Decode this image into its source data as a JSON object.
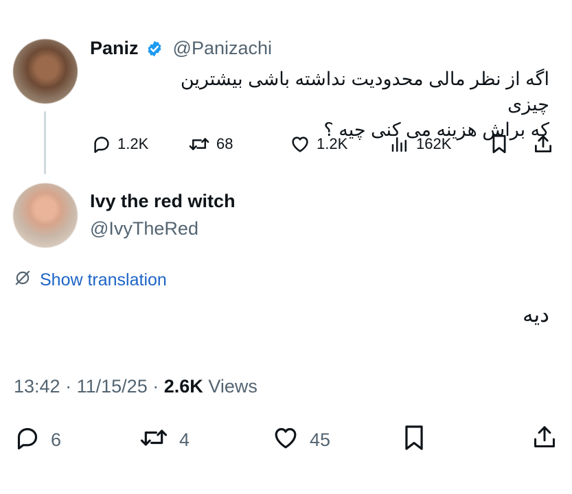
{
  "quoted_tweet": {
    "display_name": "Paniz",
    "handle": "@Panizachi",
    "text_line1": "اگه از نظر مالی محدودیت نداشته باشی بیشترین چیزی",
    "text_line2": "که براش هزینه می کنی چیه ؟",
    "replies": "1.2K",
    "reposts": "68",
    "likes": "1.2K",
    "views": "162K"
  },
  "reply_tweet": {
    "display_name": "Ivy the red witch",
    "handle": "@IvyTheRed",
    "translate_label": "Show translation",
    "text": "دیه",
    "time": "13:42",
    "date": "11/15/25",
    "views_count": "2.6K",
    "views_label": "Views",
    "separator": "·",
    "replies": "6",
    "reposts": "4",
    "likes": "45"
  },
  "colors": {
    "text": "#0f1419",
    "secondary": "#536471",
    "link": "#1d64c7",
    "verified": "#1d9bf0",
    "thread_line": "#cfd9de"
  }
}
